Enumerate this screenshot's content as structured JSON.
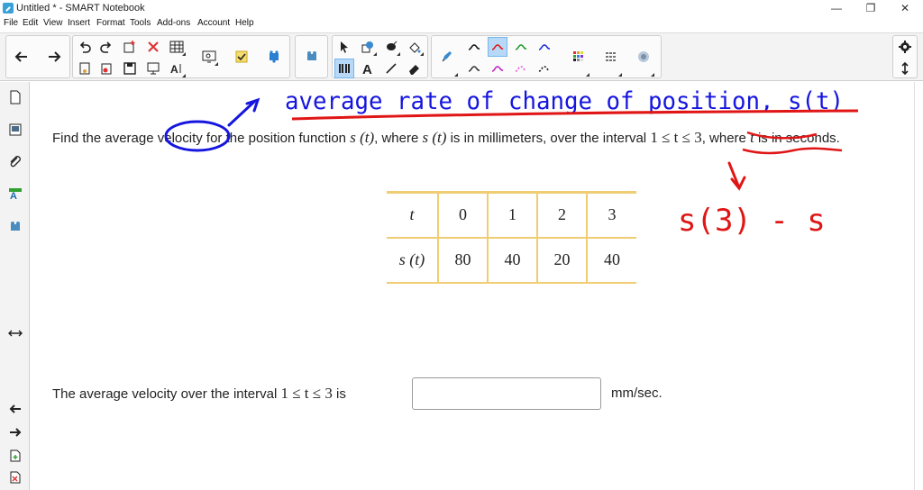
{
  "window": {
    "title": "Untitled * - SMART Notebook",
    "minimize": "—",
    "maximize": "❐",
    "close": "✕"
  },
  "menu": [
    "File",
    "Edit",
    "View",
    "Insert",
    "Format",
    "Tools",
    "Add-ons",
    "Account",
    "Help"
  ],
  "question": {
    "part1": "Find the average velocity for the position function ",
    "s_t_1": "s (t)",
    "part2": ", where ",
    "s_t_2": "s (t)",
    "part3": " is in millimeters, over the interval ",
    "interval": "1 ≤ t ≤ 3",
    "part4": ", where ",
    "t_var": "t",
    "part5": " is in seconds."
  },
  "table": {
    "row1": [
      "t",
      "0",
      "1",
      "2",
      "3"
    ],
    "row2": [
      "s (t)",
      "80",
      "40",
      "20",
      "40"
    ]
  },
  "answer": {
    "prompt_pre": "The average velocity over the interval ",
    "prompt_interval": "1 ≤ t ≤ 3",
    "prompt_post": " is",
    "value": "",
    "unit": "mm/sec."
  },
  "annotations": {
    "heading": "average rate of change of position, s(t)",
    "formula": "s(3) - s"
  },
  "colors": {
    "ink_blue": "#1515e0",
    "ink_red": "#e01515",
    "table_border": "#f0cd72",
    "selected_tool": "#b7d9f7"
  },
  "icons": {
    "toolbar": [
      "back-arrow-icon",
      "forward-arrow-icon",
      "undo-icon",
      "redo-icon",
      "add-page-icon",
      "delete-icon",
      "table-icon",
      "screen-shade-icon",
      "add-ons-icon",
      "gallery-icon",
      "select-icon",
      "shape-icon",
      "fill-icon",
      "pen-icon",
      "text-icon",
      "line-icon",
      "eraser-icon",
      "color-palette-icon",
      "line-style-icon",
      "properties-icon",
      "settings-icon",
      "toolbar-move-icon"
    ],
    "sidebar": [
      "page-sorter-icon",
      "gallery-icon",
      "attachments-icon",
      "properties-icon",
      "add-ons-icon",
      "resize-arrows-icon",
      "previous-page-icon",
      "next-page-icon"
    ]
  }
}
